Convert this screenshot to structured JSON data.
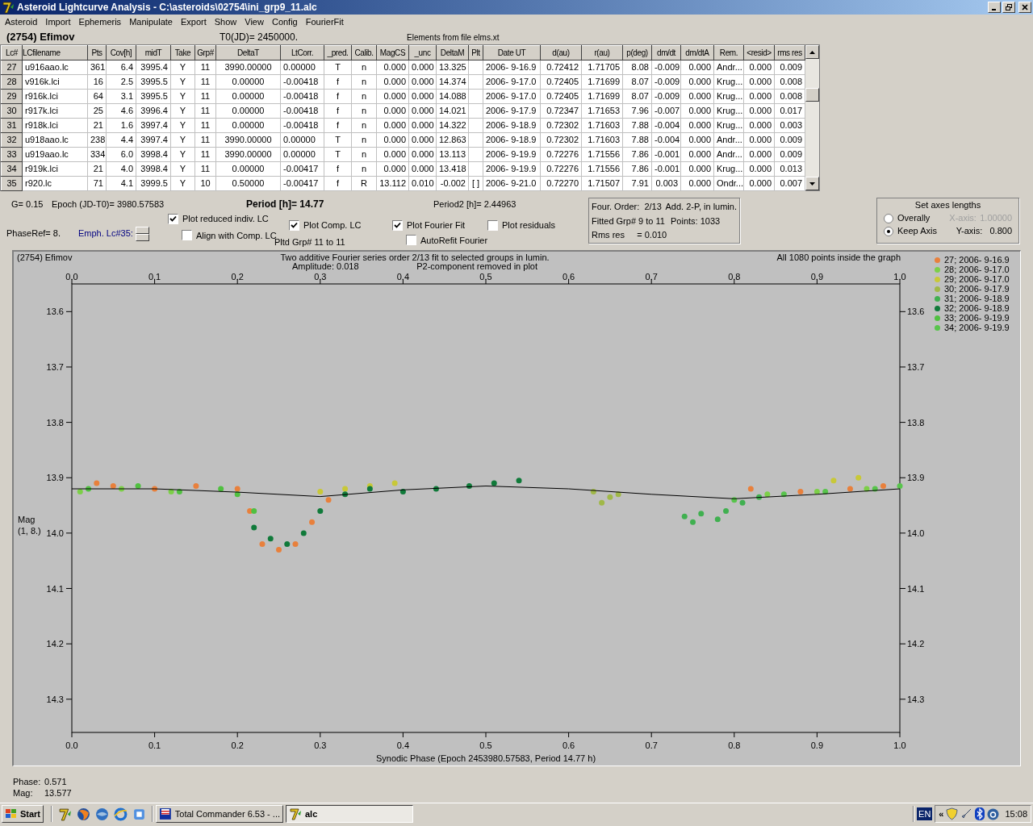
{
  "window": {
    "title": "Asteroid Lightcurve Analysis - C:\\asteroids\\02754\\ini_grp9_11.alc"
  },
  "menu": [
    "Asteroid",
    "Import",
    "Ephemeris",
    "Manipulate",
    "Export",
    "Show",
    "View",
    "Config",
    "FourierFit"
  ],
  "header": {
    "object": "(2754) Efimov",
    "t0": "T0(JD)= 2450000.",
    "elements": "Elements from file elms.xt"
  },
  "table": {
    "columns": [
      "Lc#",
      "LCfilename",
      "Pts",
      "Cov[h]",
      "midT",
      "Take",
      "Grp#",
      "DeltaT",
      "LtCorr.",
      "_pred.",
      "Calib.",
      "MagCS",
      "_unc",
      "DeltaM",
      "Plt",
      "Date UT",
      "d(au)",
      "r(au)",
      "p(deg)",
      "dm/dt",
      "dm/dtA",
      "Rem.",
      "<resid>",
      "rms res"
    ],
    "rows": [
      [
        "27",
        "u916aao.lc",
        "361",
        "6.4",
        "3995.4",
        "Y",
        "11",
        "3990.00000",
        "0.00000",
        "T",
        "n",
        "0.000",
        "0.000",
        "13.325",
        "",
        "2006- 9-16.9",
        "0.72412",
        "1.71705",
        "8.08",
        "-0.009",
        "0.000",
        "Andr...",
        "0.000",
        "0.009"
      ],
      [
        "28",
        "v916k.lci",
        "16",
        "2.5",
        "3995.5",
        "Y",
        "11",
        "0.00000",
        "-0.00418",
        "f",
        "n",
        "0.000",
        "0.000",
        "14.374",
        "",
        "2006- 9-17.0",
        "0.72405",
        "1.71699",
        "8.07",
        "-0.009",
        "0.000",
        "Krug...",
        "0.000",
        "0.008"
      ],
      [
        "29",
        "r916k.lci",
        "64",
        "3.1",
        "3995.5",
        "Y",
        "11",
        "0.00000",
        "-0.00418",
        "f",
        "n",
        "0.000",
        "0.000",
        "14.088",
        "",
        "2006- 9-17.0",
        "0.72405",
        "1.71699",
        "8.07",
        "-0.009",
        "0.000",
        "Krug...",
        "0.000",
        "0.008"
      ],
      [
        "30",
        "r917k.lci",
        "25",
        "4.6",
        "3996.4",
        "Y",
        "11",
        "0.00000",
        "-0.00418",
        "f",
        "n",
        "0.000",
        "0.000",
        "14.021",
        "",
        "2006- 9-17.9",
        "0.72347",
        "1.71653",
        "7.96",
        "-0.007",
        "0.000",
        "Krug...",
        "0.000",
        "0.017"
      ],
      [
        "31",
        "r918k.lci",
        "21",
        "1.6",
        "3997.4",
        "Y",
        "11",
        "0.00000",
        "-0.00418",
        "f",
        "n",
        "0.000",
        "0.000",
        "14.322",
        "",
        "2006- 9-18.9",
        "0.72302",
        "1.71603",
        "7.88",
        "-0.004",
        "0.000",
        "Krug...",
        "0.000",
        "0.003"
      ],
      [
        "32",
        "u918aao.lc",
        "238",
        "4.4",
        "3997.4",
        "Y",
        "11",
        "3990.00000",
        "0.00000",
        "T",
        "n",
        "0.000",
        "0.000",
        "12.863",
        "",
        "2006- 9-18.9",
        "0.72302",
        "1.71603",
        "7.88",
        "-0.004",
        "0.000",
        "Andr...",
        "0.000",
        "0.009"
      ],
      [
        "33",
        "u919aao.lc",
        "334",
        "6.0",
        "3998.4",
        "Y",
        "11",
        "3990.00000",
        "0.00000",
        "T",
        "n",
        "0.000",
        "0.000",
        "13.113",
        "",
        "2006- 9-19.9",
        "0.72276",
        "1.71556",
        "7.86",
        "-0.001",
        "0.000",
        "Andr...",
        "0.000",
        "0.009"
      ],
      [
        "34",
        "r919k.lci",
        "21",
        "4.0",
        "3998.4",
        "Y",
        "11",
        "0.00000",
        "-0.00417",
        "f",
        "n",
        "0.000",
        "0.000",
        "13.418",
        "",
        "2006- 9-19.9",
        "0.72276",
        "1.71556",
        "7.86",
        "-0.001",
        "0.000",
        "Krug...",
        "0.000",
        "0.013"
      ],
      [
        "35",
        "r920.lc",
        "71",
        "4.1",
        "3999.5",
        "Y",
        "10",
        "0.50000",
        "-0.00417",
        "f",
        "R",
        "13.112",
        "0.010",
        "-0.002",
        "[ ]",
        "2006- 9-21.0",
        "0.72270",
        "1.71507",
        "7.91",
        "0.003",
        "0.000",
        "Ondr...",
        "0.000",
        "0.007"
      ]
    ]
  },
  "params": {
    "g": "G= 0.15",
    "epoch": "Epoch (JD-T0)= 3980.57583",
    "period": "Period [h]= 14.77",
    "period2": "Period2 [h]= 2.44963",
    "phase_ref": "PhaseRef= 8.",
    "emph": "Emph. Lc#35:",
    "pltd_grp": "Pltd Grp#  11 to  11"
  },
  "checkboxes": [
    {
      "label": "Plot reduced indiv. LC",
      "checked": true
    },
    {
      "label": "Align with Comp. LC",
      "checked": false
    },
    {
      "label": "Plot Comp. LC",
      "checked": true
    },
    {
      "label": "Plot Fourier Fit",
      "checked": true
    },
    {
      "label": "Plot residuals",
      "checked": false
    },
    {
      "label": "AutoRefit Fourier",
      "checked": false
    }
  ],
  "fit_box": {
    "lines": [
      [
        "Four. Order:  2/13",
        "Add. 2-P, in lumin."
      ],
      [
        "Fitted Grp# 9 to 11",
        "Points: 1033"
      ],
      [
        "Rms res     = 0.010"
      ]
    ]
  },
  "axes_box": {
    "title": "Set axes lengths",
    "options": [
      {
        "label": "Overally",
        "selected": false,
        "axis": "X-axis:",
        "value": "1.00000",
        "disabled": true
      },
      {
        "label": "Keep Axis",
        "selected": true,
        "axis": "Y-axis:",
        "value": "0.800",
        "disabled": false
      }
    ]
  },
  "plot": {
    "object": "(2754) Efimov",
    "title": "Two additive Fourier series order 2/13 fit to selected groups in lumin.",
    "subtitle": [
      "Amplitude: 0.018",
      "P2-component removed in plot"
    ],
    "note": "All 1080 points inside the graph",
    "ylabel_note": "(1, 8.)",
    "chart_data": {
      "type": "scatter",
      "xlabel": "Synodic Phase (Epoch 2453980.57583, Period 14.77 h)",
      "ylabel": "Mag",
      "xlim": [
        0,
        1
      ],
      "ylim": [
        14.36,
        13.55
      ],
      "xticks": [
        {
          "value": 0,
          "label": "0.0"
        },
        {
          "value": 0.1,
          "label": "0.1"
        },
        {
          "value": 0.2,
          "label": "0.2"
        },
        {
          "value": 0.3,
          "label": "0.3"
        },
        {
          "value": 0.4,
          "label": "0.4"
        },
        {
          "value": 0.5,
          "label": "0.5"
        },
        {
          "value": 0.6,
          "label": "0.6"
        },
        {
          "value": 0.7,
          "label": "0.7"
        },
        {
          "value": 0.8,
          "label": "0.8"
        },
        {
          "value": 0.9,
          "label": "0.9"
        },
        {
          "value": 1,
          "label": "1.0"
        }
      ],
      "yticks": [
        {
          "value": 13.6,
          "label": "13.6"
        },
        {
          "value": 13.7,
          "label": "13.7"
        },
        {
          "value": 13.8,
          "label": "13.8"
        },
        {
          "value": 13.9,
          "label": "13.9"
        },
        {
          "value": 14.0,
          "label": "14.0"
        },
        {
          "value": 14.1,
          "label": "14.1"
        },
        {
          "value": 14.2,
          "label": "14.2"
        },
        {
          "value": 14.3,
          "label": "14.3"
        }
      ],
      "series": [
        {
          "name": "27; 2006- 9-16.9",
          "color": "#e8803c",
          "x": [
            0.03,
            0.05,
            0.1,
            0.15,
            0.2,
            0.215,
            0.23,
            0.25,
            0.27,
            0.29,
            0.31,
            0.82,
            0.88,
            0.94,
            0.98
          ],
          "values": [
            13.91,
            13.915,
            13.92,
            13.915,
            13.92,
            13.96,
            14.02,
            14.03,
            14.02,
            13.98,
            13.94,
            13.92,
            13.925,
            13.92,
            13.915
          ]
        },
        {
          "name": "28; 2006- 9-17.0",
          "color": "#7ccf48",
          "x": [
            0.01,
            0.06,
            0.12,
            0.84,
            0.9,
            0.96
          ],
          "values": [
            13.925,
            13.92,
            13.925,
            13.93,
            13.925,
            13.92
          ]
        },
        {
          "name": "29; 2006- 9-17.0",
          "color": "#c8c838",
          "x": [
            0.3,
            0.33,
            0.36,
            0.39,
            0.92,
            0.95
          ],
          "values": [
            13.925,
            13.92,
            13.915,
            13.91,
            13.905,
            13.9
          ]
        },
        {
          "name": "30; 2006- 9-17.9",
          "color": "#a0b848",
          "x": [
            0.63,
            0.65,
            0.66,
            0.64
          ],
          "values": [
            13.925,
            13.935,
            13.93,
            13.945
          ]
        },
        {
          "name": "31; 2006- 9-18.9",
          "color": "#40b050",
          "x": [
            0.74,
            0.75,
            0.76,
            0.78,
            0.79,
            0.81,
            0.83
          ],
          "values": [
            13.97,
            13.98,
            13.965,
            13.975,
            13.96,
            13.945,
            13.935
          ]
        },
        {
          "name": "32; 2006- 9-18.9",
          "color": "#107a3a",
          "x": [
            0.22,
            0.24,
            0.26,
            0.28,
            0.3,
            0.33,
            0.36,
            0.4,
            0.44,
            0.48,
            0.51,
            0.54
          ],
          "values": [
            13.99,
            14.01,
            14.02,
            14.0,
            13.96,
            13.93,
            13.92,
            13.925,
            13.92,
            13.915,
            13.91,
            13.905
          ]
        },
        {
          "name": "33; 2006- 9-19.9",
          "color": "#50c040",
          "x": [
            0.02,
            0.08,
            0.13,
            0.18,
            0.2,
            0.22
          ],
          "values": [
            13.92,
            13.915,
            13.925,
            13.92,
            13.93,
            13.96
          ]
        },
        {
          "name": "34; 2006- 9-19.9",
          "color": "#58c44c",
          "x": [
            0.8,
            0.86,
            0.91,
            0.97,
            1
          ],
          "values": [
            13.94,
            13.93,
            13.925,
            13.92,
            13.915
          ]
        },
        {
          "type": "line",
          "color": "#000000",
          "x": [
            0,
            0.1,
            0.2,
            0.3,
            0.4,
            0.5,
            0.6,
            0.7,
            0.8,
            0.9,
            1
          ],
          "values": [
            13.92,
            13.92,
            13.926,
            13.934,
            13.922,
            13.915,
            13.92,
            13.93,
            13.938,
            13.93,
            13.92
          ]
        }
      ]
    }
  },
  "status": [
    {
      "label": "Phase:",
      "value": "0.571"
    },
    {
      "label": "Mag:",
      "value": "13.577"
    }
  ],
  "taskbar": {
    "start": "Start",
    "tasks": [
      {
        "label": "Total Commander 6.53 - ...",
        "selected": false
      },
      {
        "label": "alc",
        "selected": true
      }
    ],
    "lang": "EN",
    "chevron": "«",
    "clock": "15:08"
  }
}
